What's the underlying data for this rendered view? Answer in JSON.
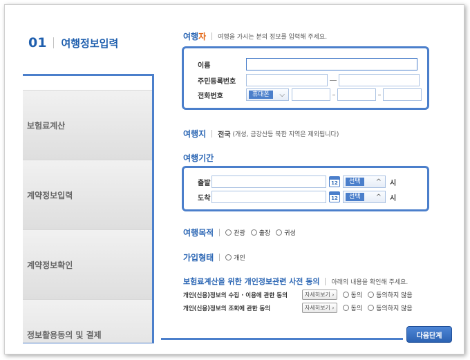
{
  "page": {
    "number": "01",
    "title": "여행정보입력"
  },
  "steps": [
    {
      "label": ""
    },
    {
      "label": "보험료계산"
    },
    {
      "label": "계약정보입력"
    },
    {
      "label": "계약정보확인"
    },
    {
      "label": "정보활용동의 및 결제"
    }
  ],
  "traveler": {
    "title_a": "여행",
    "title_b": "자",
    "desc": "여행을 가시는 분의 정보를 입력해 주세요.",
    "name_label": "이름",
    "name_value": "",
    "rrn_label": "주민등록번호",
    "phone_label": "전화번호",
    "phone_type": "휴대폰",
    "arrow": "⌵"
  },
  "destination": {
    "title": "여행지",
    "value": "전국",
    "note": "(개성, 금강산등 북한 지역은 제외됩니다)"
  },
  "period": {
    "title": "여행기간",
    "depart_label": "출발",
    "arrive_label": "도착",
    "cal_num": "12",
    "select_value": "선택",
    "arrow": "^",
    "unit": "시"
  },
  "purpose": {
    "title": "여행목적",
    "options": [
      "관광",
      "출장",
      "귀성"
    ]
  },
  "join_type": {
    "title": "가입형태",
    "options": [
      "개인"
    ]
  },
  "consent": {
    "title": "보험료계산을 위한 개인정보관련 사전 동의",
    "desc": "아래의 내용을 확인해 주세요.",
    "rows": [
      {
        "label": "개인(신용)정보의 수집 · 이용에 관한 동의",
        "detail": "자세히보기 ›",
        "agree": "동의",
        "disagree": "동의하지 않음"
      },
      {
        "label": "개인(신용)정보의 조회에 관한 동의",
        "detail": "자세히보기 ›",
        "agree": "동의",
        "disagree": "동의하지 않음"
      }
    ]
  },
  "next_label": "다음단계"
}
